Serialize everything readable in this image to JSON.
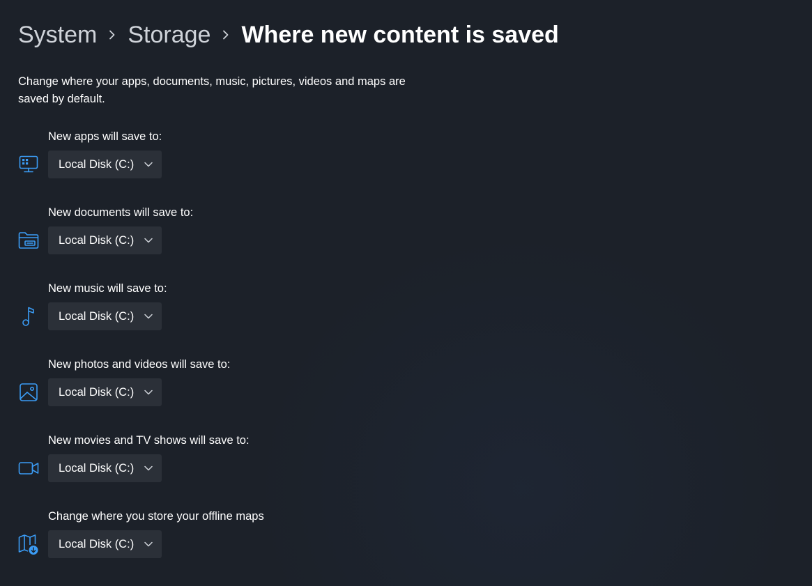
{
  "breadcrumb": {
    "items": [
      "System",
      "Storage"
    ],
    "current": "Where new content is saved"
  },
  "description": "Change where your apps, documents, music, pictures, videos and maps are saved by default.",
  "accent_color": "#3b9cf5",
  "settings": [
    {
      "label": "New apps will save to:",
      "value": "Local Disk (C:)",
      "icon": "apps-monitor-icon"
    },
    {
      "label": "New documents will save to:",
      "value": "Local Disk (C:)",
      "icon": "documents-folder-icon"
    },
    {
      "label": "New music will save to:",
      "value": "Local Disk (C:)",
      "icon": "music-note-icon"
    },
    {
      "label": "New photos and videos will save to:",
      "value": "Local Disk (C:)",
      "icon": "photo-icon"
    },
    {
      "label": "New movies and TV shows will save to:",
      "value": "Local Disk (C:)",
      "icon": "video-camera-icon"
    },
    {
      "label": "Change where you store your offline maps",
      "value": "Local Disk (C:)",
      "icon": "offline-maps-icon"
    }
  ]
}
